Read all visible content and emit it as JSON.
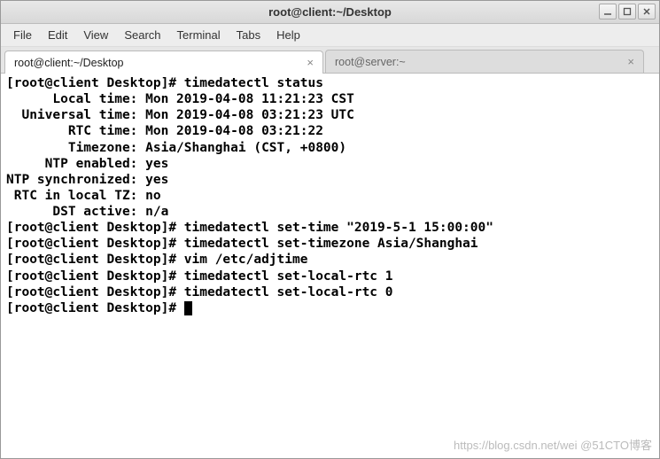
{
  "window": {
    "title": "root@client:~/Desktop"
  },
  "menubar": {
    "items": [
      "File",
      "Edit",
      "View",
      "Search",
      "Terminal",
      "Tabs",
      "Help"
    ]
  },
  "tabs": [
    {
      "label": "root@client:~/Desktop",
      "active": true
    },
    {
      "label": "root@server:~",
      "active": false
    }
  ],
  "terminal": {
    "lines": [
      "[root@client Desktop]# timedatectl status",
      "      Local time: Mon 2019-04-08 11:21:23 CST",
      "  Universal time: Mon 2019-04-08 03:21:23 UTC",
      "        RTC time: Mon 2019-04-08 03:21:22",
      "        Timezone: Asia/Shanghai (CST, +0800)",
      "     NTP enabled: yes",
      "NTP synchronized: yes",
      " RTC in local TZ: no",
      "      DST active: n/a",
      "[root@client Desktop]# timedatectl set-time \"2019-5-1 15:00:00\"",
      "[root@client Desktop]# timedatectl set-timezone Asia/Shanghai",
      "[root@client Desktop]# vim /etc/adjtime",
      "[root@client Desktop]# timedatectl set-local-rtc 1",
      "[root@client Desktop]# timedatectl set-local-rtc 0",
      "[root@client Desktop]# "
    ]
  },
  "watermark": "https://blog.csdn.net/wei @51CTO博客"
}
